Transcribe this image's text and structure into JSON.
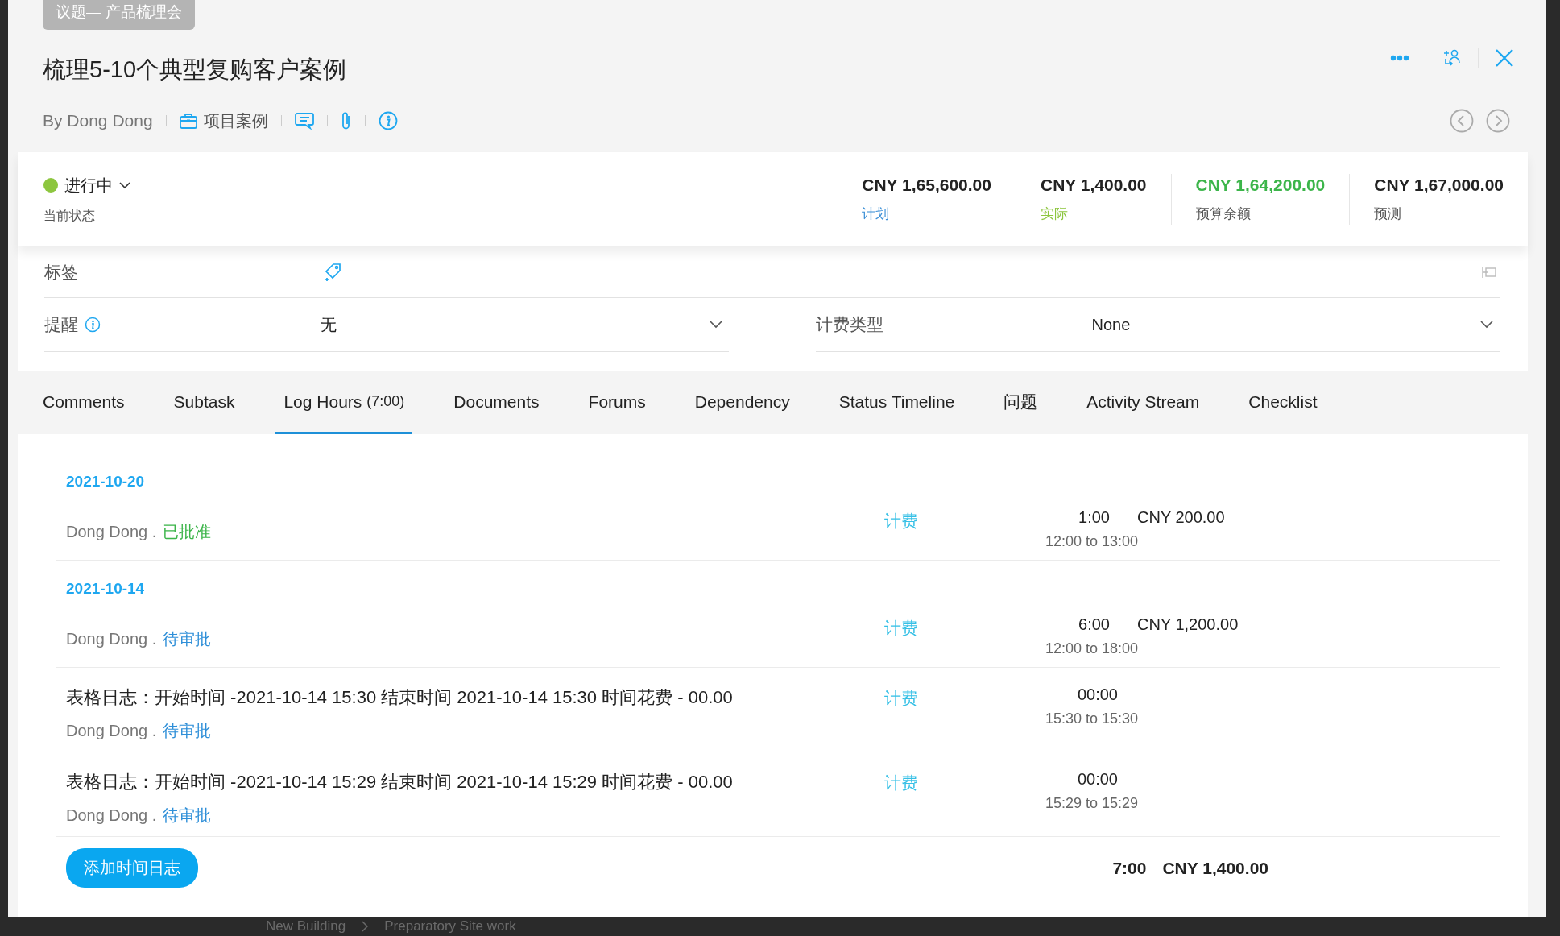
{
  "topic_tag": "议题— 产品梳理会",
  "title": "梳理5-10个典型复购客户案例",
  "meta": {
    "author": "By Dong Dong",
    "project": "项目案例"
  },
  "status": {
    "label": "进行中",
    "color": "#8dc63f",
    "caption": "当前状态"
  },
  "budget": [
    {
      "kind": "plan",
      "amount": "CNY 1,65,600.00",
      "label": "计划"
    },
    {
      "kind": "actual",
      "amount": "CNY 1,400.00",
      "label": "实际"
    },
    {
      "kind": "remaining",
      "amount": "CNY 1,64,200.00",
      "label": "预算余额"
    },
    {
      "kind": "forecast",
      "amount": "CNY 1,67,000.00",
      "label": "预测"
    }
  ],
  "tags_field": {
    "label": "标签"
  },
  "fields": [
    {
      "label": "提醒",
      "info": true,
      "value": "无"
    },
    {
      "label": "计费类型",
      "info": false,
      "value": "None"
    }
  ],
  "tabs": [
    {
      "label": "Comments",
      "selected": false
    },
    {
      "label": "Subtask",
      "selected": false
    },
    {
      "label": "Log Hours",
      "count": "(7:00)",
      "selected": true
    },
    {
      "label": "Documents",
      "selected": false
    },
    {
      "label": "Forums",
      "selected": false
    },
    {
      "label": "Dependency",
      "selected": false
    },
    {
      "label": "Status Timeline",
      "selected": false
    },
    {
      "label": "问题",
      "selected": false
    },
    {
      "label": "Activity Stream",
      "selected": false
    },
    {
      "label": "Checklist",
      "selected": false
    }
  ],
  "log_groups": [
    {
      "date": "2021-10-20",
      "entries": [
        {
          "user": "Dong Dong .",
          "status": {
            "text": "已批准",
            "color": "#3cb54a"
          },
          "billing": "计费",
          "hours": "1:00",
          "amount": "CNY 200.00",
          "range": "12:00 to 13:00"
        }
      ]
    },
    {
      "date": "2021-10-14",
      "entries": [
        {
          "user": "Dong Dong .",
          "status": {
            "text": "待审批",
            "color": "#2f8fd8"
          },
          "billing": "计费",
          "hours": "6:00",
          "amount": "CNY 1,200.00",
          "range": "12:00 to 18:00"
        },
        {
          "description": "表格日志：开始时间 -2021-10-14 15:30 结束时间 2021-10-14 15:30 时间花费 - 00.00",
          "user": "Dong Dong .",
          "status": {
            "text": "待审批",
            "color": "#2f8fd8"
          },
          "billing": "计费",
          "hours": "00:00",
          "range": "15:30 to 15:30"
        },
        {
          "description": "表格日志：开始时间 -2021-10-14 15:29 结束时间 2021-10-14 15:29 时间花费 - 00.00",
          "user": "Dong Dong .",
          "status": {
            "text": "待审批",
            "color": "#2f8fd8"
          },
          "billing": "计费",
          "hours": "00:00",
          "range": "15:29 to 15:29"
        }
      ]
    }
  ],
  "add_button": "添加时间日志",
  "totals": {
    "hours": "7:00",
    "amount": "CNY 1,400.00"
  },
  "background": {
    "breadcrumb": [
      "New Building",
      "Preparatory Site work"
    ]
  }
}
